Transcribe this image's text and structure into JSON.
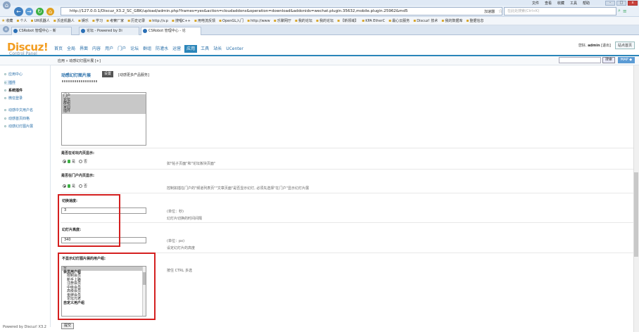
{
  "browser": {
    "menu": [
      "文件",
      "查看",
      "收藏",
      "工具",
      "帮助"
    ],
    "win_controls": [
      "-",
      "□",
      "x"
    ],
    "url": "http://127.0.0.1/Discuz_X3.2_SC_GBK/upload/admin.php?frames=yes&action=cloudaddons&operation=download&addonids=wechat.plugin.35632,mobile.plugin.25962&md5",
    "url_suffix": "加速器",
    "search_placeholder": "在此处搜索(Ctrl+K)",
    "bookmarks": [
      "收藏",
      "个人",
      "UR机器人",
      "沃途机器人",
      "娱乐",
      "学习",
      "考察厂家",
      "历史记录",
      "http://v.p",
      "搜唱C++",
      "用电流反馈",
      "OpenGL入门",
      "http://www",
      "乐聚网厅",
      "我的论坛",
      "我的论坛",
      "【新领域】",
      "KPA EtherC",
      "最心云服务",
      "Discuz! 技术",
      "我的数据库",
      "整据信息"
    ],
    "tabs": [
      {
        "label": "CSRobot 管理中心 - 新",
        "active": false
      },
      {
        "label": "论坛 - Powered by Di",
        "active": false
      },
      {
        "label": "CSRobot 管理中心 - 论",
        "active": true
      }
    ]
  },
  "header": {
    "logo": "Discuz!",
    "logo_sub": "Control Panel",
    "nav": [
      {
        "label": "首页",
        "active": false
      },
      {
        "label": "全局",
        "active": false
      },
      {
        "label": "界面",
        "active": false
      },
      {
        "label": "内容",
        "active": false
      },
      {
        "label": "用户",
        "active": false
      },
      {
        "label": "门户",
        "active": false
      },
      {
        "label": "论坛",
        "active": false
      },
      {
        "label": "群组",
        "active": false
      },
      {
        "label": "防灌水",
        "active": false
      },
      {
        "label": "运营",
        "active": false
      },
      {
        "label": "应用",
        "active": true
      },
      {
        "label": "工具",
        "active": false
      },
      {
        "label": "站长",
        "active": false
      },
      {
        "label": "UCenter",
        "active": false
      }
    ],
    "user_prefix": "您好,",
    "user_name": "admin",
    "logout": "[退出]",
    "site_home": "站点首页"
  },
  "breadcrumb": "应用 » 动感幻灯图片展 [+]",
  "top_search_btn": "搜索",
  "map_btn": "MAP ◆",
  "sidebar": {
    "items": [
      {
        "label": "应用中心",
        "type": "item"
      },
      {
        "label": "插件",
        "type": "current"
      },
      {
        "label": "系统插件",
        "type": "group"
      },
      {
        "label": "微信登录",
        "type": "item"
      },
      {
        "label": "动感中文用户名",
        "type": "item"
      },
      {
        "label": "动感首页四格",
        "type": "item"
      },
      {
        "label": "动感幻灯图片展",
        "type": "item"
      }
    ],
    "footer": "Powered by Discuz! X3.2"
  },
  "main": {
    "plugin_title": "动感幻灯图片展",
    "settings_btn": "设置",
    "more_link": "[动感更多产品服务]",
    "position_options": [
      "门户",
      "论坛",
      "群组",
      "家园",
      "插件"
    ],
    "forum_page": {
      "label": "是否在论坛内页显示:",
      "yes": "是",
      "no": "否",
      "hint": "如\"帖子页面\"和\"论坛板块页面\""
    },
    "portal_page": {
      "label": "是否在门户内页显示:",
      "yes": "是",
      "no": "否",
      "hint": "控制如插在门户的\"频道列表页\"\"文章页面\"是否显示幻灯, 必须先选择\"在门户\"显示幻灯片展"
    },
    "speed": {
      "label": "切换速度:",
      "value": "3",
      "unit": "(单位：秒)",
      "desc": "幻灯片切换的时间间隔"
    },
    "height": {
      "label": "幻灯片高度:",
      "value": "340",
      "unit": "(单位：px)",
      "desc": "设定幻灯片的高度"
    },
    "hidden_groups": {
      "label": "不显示幻灯图片展的用户组:",
      "hint": "按住 CTRL 多选",
      "options": [
        {
          "label": "空",
          "indent": false,
          "bold": false,
          "sel": true
        },
        {
          "label": "会员用户组",
          "indent": false,
          "bold": true,
          "sel": false
        },
        {
          "label": "限制会员",
          "indent": true,
          "bold": false,
          "sel": false
        },
        {
          "label": "新手上路",
          "indent": true,
          "bold": false,
          "sel": false
        },
        {
          "label": "注册会员",
          "indent": true,
          "bold": false,
          "sel": false
        },
        {
          "label": "中级会员",
          "indent": true,
          "bold": false,
          "sel": false
        },
        {
          "label": "高级会员",
          "indent": true,
          "bold": false,
          "sel": false
        },
        {
          "label": "金牌会员",
          "indent": true,
          "bold": false,
          "sel": false
        },
        {
          "label": "论坛元老",
          "indent": true,
          "bold": false,
          "sel": false
        },
        {
          "label": "自定义用户组",
          "indent": false,
          "bold": true,
          "sel": false
        }
      ]
    },
    "submit": "提交"
  },
  "colors": {
    "accent": "#2a85b9",
    "logo": "#f29c1f",
    "highlight": "#d41f1f"
  }
}
